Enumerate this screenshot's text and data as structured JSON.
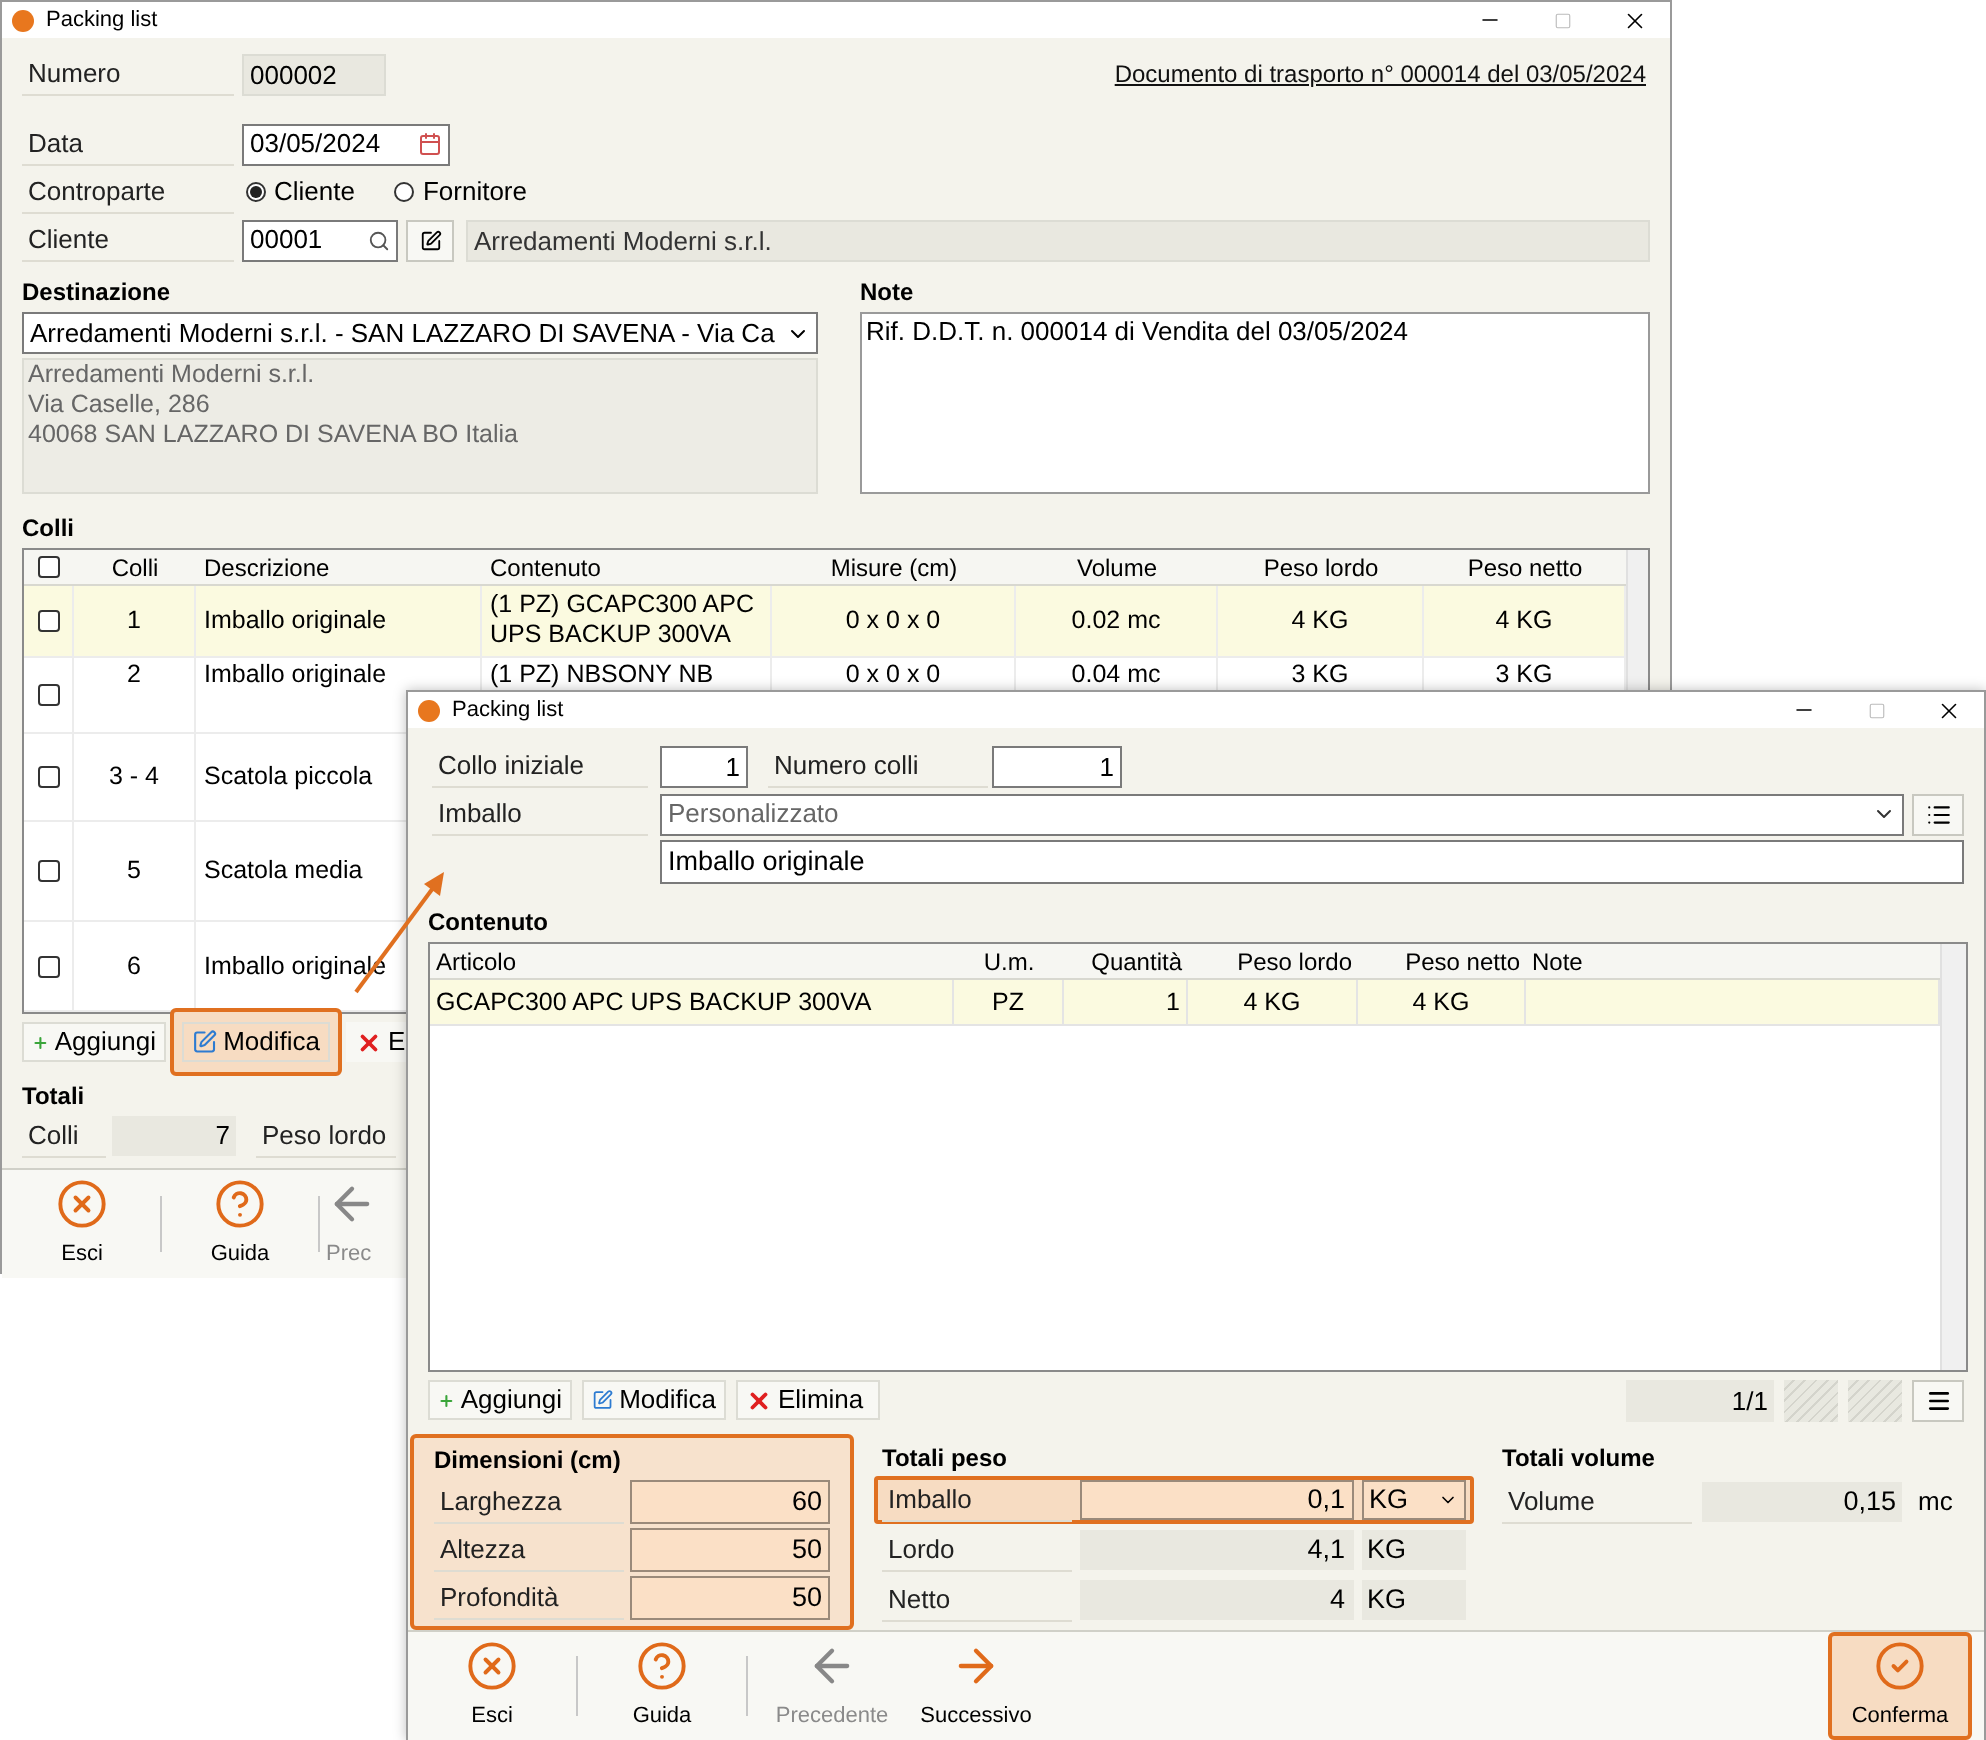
{
  "main_window": {
    "title": "Packing list",
    "numero_label": "Numero",
    "numero": "000002",
    "document_link": "Documento di trasporto n° 000014 del 03/05/2024",
    "data_label": "Data",
    "data": "03/05/2024",
    "controparte_label": "Controparte",
    "controparte_options": [
      {
        "label": "Cliente",
        "selected": true
      },
      {
        "label": "Fornitore",
        "selected": false
      }
    ],
    "cliente_label": "Cliente",
    "cliente_code": "00001",
    "cliente_name": "Arredamenti Moderni s.r.l.",
    "destinazione_label": "Destinazione",
    "destinazione": "Arredamenti Moderni s.r.l. - SAN LAZZARO DI SAVENA - Via Ca",
    "address_lines": [
      "Arredamenti Moderni s.r.l.",
      "Via Caselle, 286",
      "40068 SAN LAZZARO DI SAVENA BO Italia"
    ],
    "note_label": "Note",
    "note": "Rif. D.D.T. n. 000014 di Vendita del 03/05/2024",
    "colli_label": "Colli",
    "table": {
      "header_checked": false,
      "columns": [
        "Colli",
        "Descrizione",
        "Contenuto",
        "Misure (cm)",
        "Volume",
        "Peso lordo",
        "Peso netto"
      ],
      "rows": [
        {
          "checked": false,
          "selected": true,
          "cells": [
            "1",
            "Imballo originale",
            "(1 PZ) GCAPC300 APC UPS BACKUP 300VA",
            "0 x 0 x 0",
            "0.02 mc",
            "4 KG",
            "4 KG"
          ]
        },
        {
          "checked": false,
          "selected": false,
          "cells": [
            "2",
            "Imballo originale",
            "(1 PZ) NBSONY NB",
            "0 x 0 x 0",
            "0.04 mc",
            "3 KG",
            "3 KG"
          ]
        },
        {
          "checked": false,
          "selected": false,
          "cells": [
            "3 - 4",
            "Scatola piccola"
          ]
        },
        {
          "checked": false,
          "selected": false,
          "cells": [
            "5",
            "Scatola media"
          ]
        },
        {
          "checked": false,
          "selected": false,
          "cells": [
            "6",
            "Imballo originale"
          ]
        }
      ]
    },
    "buttons": [
      {
        "label": "Aggiungi",
        "kind": "add",
        "highlighted": false
      },
      {
        "label": "Modifica",
        "kind": "edit",
        "highlighted": true
      },
      {
        "label": "E",
        "kind": "delete",
        "highlighted": false
      }
    ],
    "totali_label": "Totali",
    "totali_colli_label": "Colli",
    "totali_colli": "7",
    "peso_lordo_label": "Peso lordo",
    "toolbar": [
      {
        "label": "Esci",
        "kind": "exit",
        "disabled": false
      },
      {
        "label": "Guida",
        "kind": "help",
        "disabled": false
      },
      {
        "label": "Prec",
        "kind": "prev",
        "disabled": true
      }
    ]
  },
  "dialog": {
    "title": "Packing list",
    "collo_iniziale_label": "Collo iniziale",
    "collo_iniziale": "1",
    "numero_colli_label": "Numero colli",
    "numero_colli": "1",
    "imballo_label": "Imballo",
    "imballo": "Personalizzato",
    "descrizione": "Imballo originale",
    "contenuto_label": "Contenuto",
    "table": {
      "columns": [
        "Articolo",
        "U.m.",
        "Quantità",
        "Peso lordo",
        "Peso netto",
        "Note"
      ],
      "rows": [
        {
          "selected": true,
          "cells": [
            "GCAPC300 APC UPS BACKUP 300VA",
            "PZ",
            "1",
            "4 KG",
            "4 KG"
          ]
        }
      ]
    },
    "buttons": [
      {
        "label": "Aggiungi",
        "kind": "add"
      },
      {
        "label": "Modifica",
        "kind": "edit"
      },
      {
        "label": "Elimina",
        "kind": "delete"
      }
    ],
    "pager": "1/1",
    "dimensioni": {
      "title": "Dimensioni (cm)",
      "highlighted": true,
      "fields": [
        {
          "label": "Larghezza",
          "value": "60"
        },
        {
          "label": "Altezza",
          "value": "50"
        },
        {
          "label": "Profondità",
          "value": "50"
        }
      ]
    },
    "totali_peso": {
      "title": "Totali peso",
      "rows": [
        {
          "label": "Imballo",
          "value": "0,1",
          "unit": "KG",
          "editable": true,
          "highlighted": true
        },
        {
          "label": "Lordo",
          "value": "4,1",
          "unit": "KG",
          "editable": false,
          "highlighted": false
        },
        {
          "label": "Netto",
          "value": "4",
          "unit": "KG",
          "editable": false,
          "highlighted": false
        }
      ]
    },
    "totali_volume": {
      "title": "Totali volume",
      "label": "Volume",
      "value": "0,15",
      "unit": "mc"
    },
    "toolbar": [
      {
        "label": "Esci",
        "kind": "exit",
        "disabled": false,
        "highlighted": false
      },
      {
        "label": "Guida",
        "kind": "help",
        "disabled": false,
        "highlighted": false
      },
      {
        "label": "Precedente",
        "kind": "prev",
        "disabled": true,
        "highlighted": false
      },
      {
        "label": "Successivo",
        "kind": "next",
        "disabled": false,
        "highlighted": false
      },
      {
        "label": "Conferma",
        "kind": "confirm",
        "disabled": false,
        "highlighted": true
      }
    ]
  }
}
